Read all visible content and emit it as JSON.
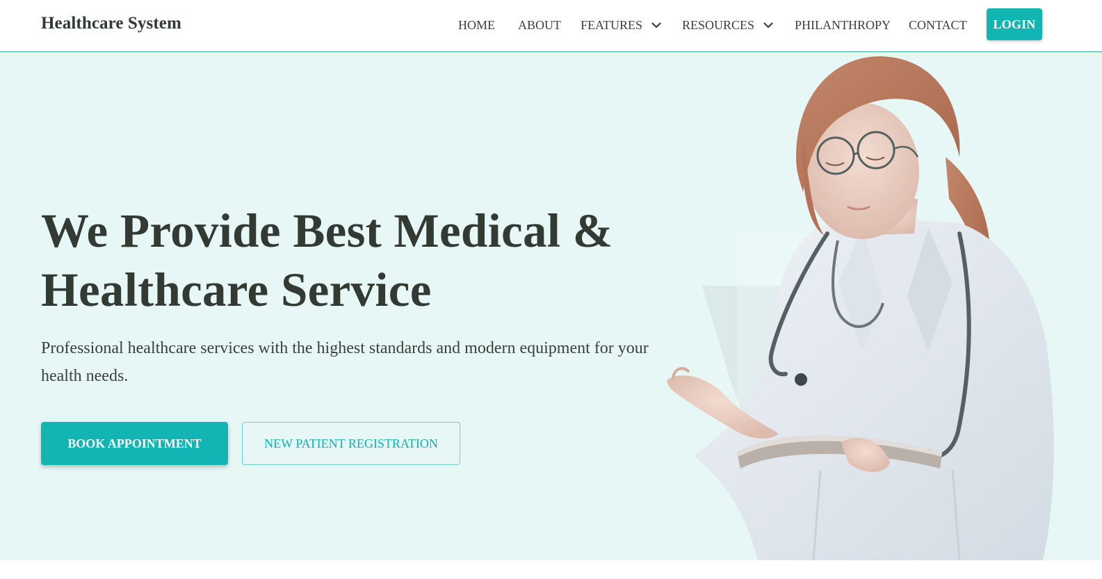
{
  "header": {
    "brand": "Healthcare System",
    "nav": [
      {
        "label": "HOME",
        "has_dropdown": false
      },
      {
        "label": "ABOUT",
        "has_dropdown": false
      },
      {
        "label": "FEATURES",
        "has_dropdown": true
      },
      {
        "label": "RESOURCES",
        "has_dropdown": true
      },
      {
        "label": "PHILANTHROPY",
        "has_dropdown": false
      },
      {
        "label": "CONTACT",
        "has_dropdown": false
      }
    ],
    "login_label": "LOGIN"
  },
  "hero": {
    "title_line1": "We Provide Best Medical &",
    "title_line2": "Healthcare Service",
    "subtitle": "Professional healthcare services with the highest standards and modern equipment for your health needs.",
    "primary_button": "BOOK APPOINTMENT",
    "secondary_button": "NEW PATIENT REGISTRATION"
  },
  "icons": {
    "dropdown": "chevron-down-icon",
    "illustration": "doctor-with-tablet"
  },
  "colors": {
    "accent": "#12b5b1",
    "hero_background": "#e6f7f6",
    "text": "#333a33",
    "header_border": "#3aa7a3"
  }
}
